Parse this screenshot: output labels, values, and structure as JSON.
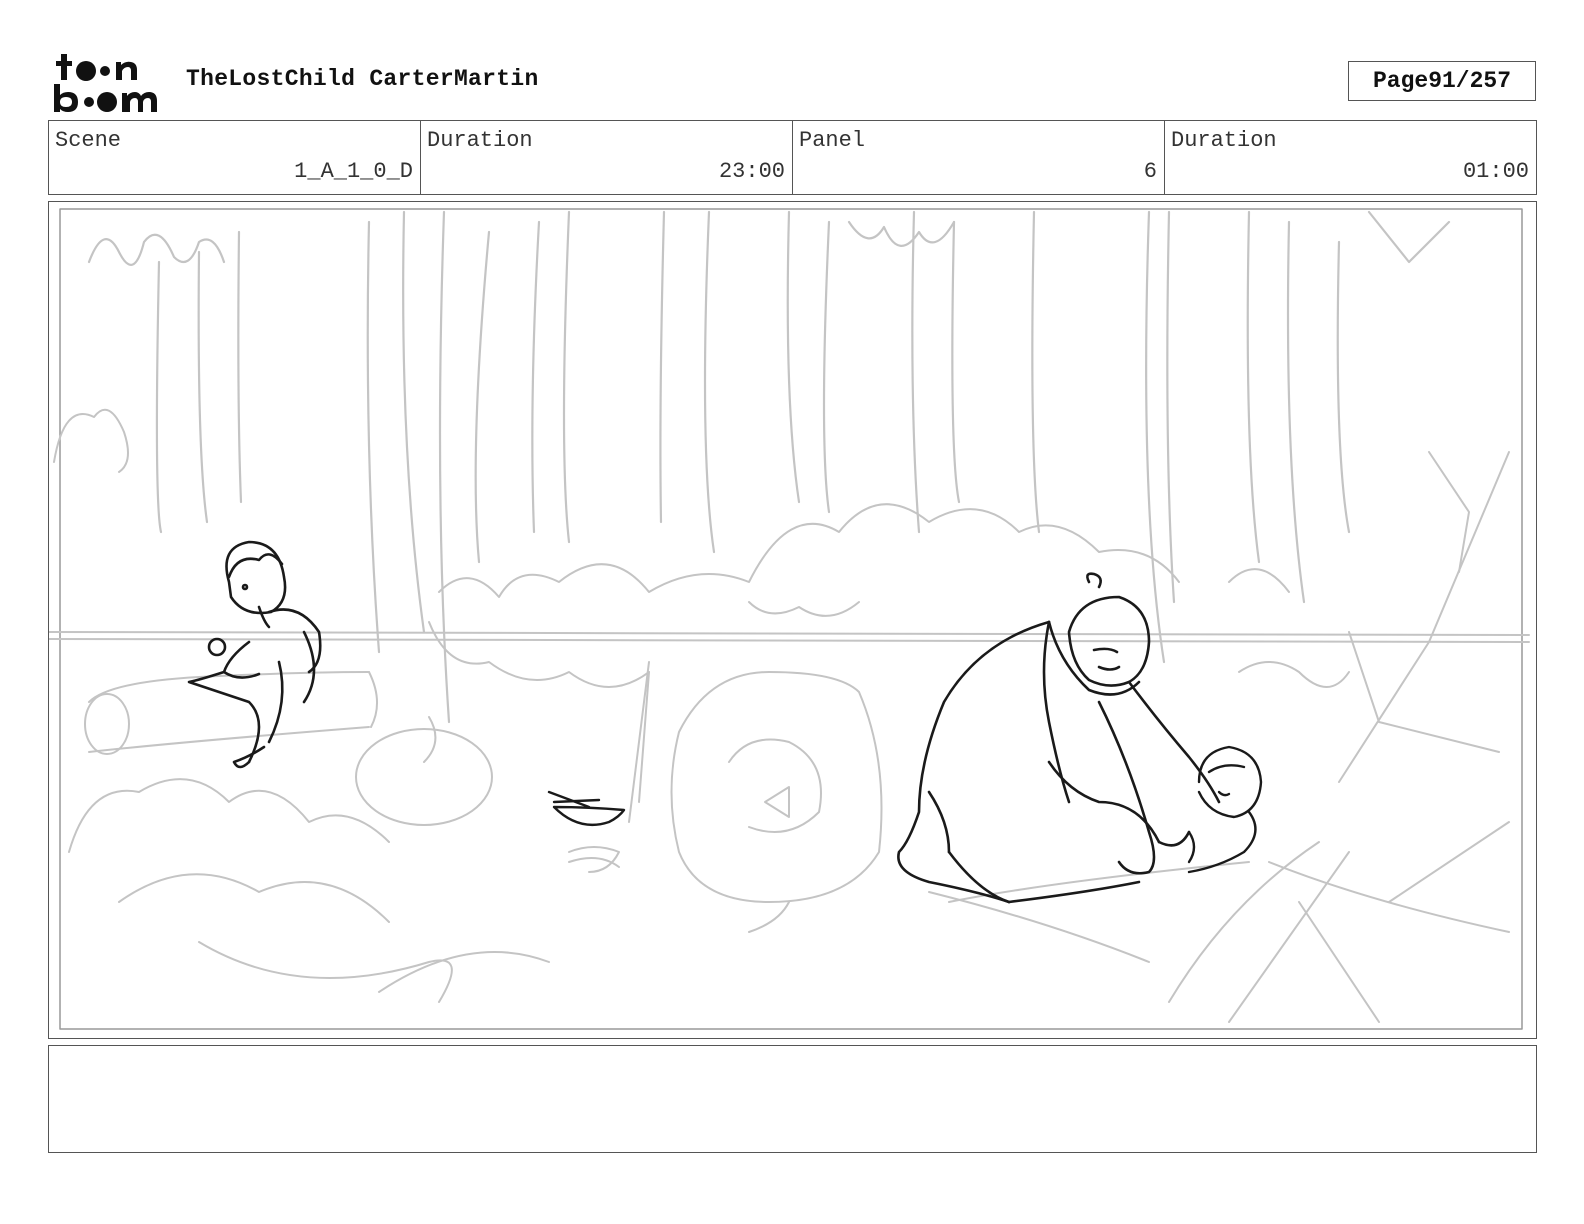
{
  "header": {
    "logo_text": "toon boom",
    "title": "TheLostChild CarterMartin",
    "page_label": "Page",
    "page_value": "91/257"
  },
  "info": {
    "scene_label": "Scene",
    "scene_value": "1_A_1_0_D",
    "scene_duration_label": "Duration",
    "scene_duration_value": "23:00",
    "panel_label": "Panel",
    "panel_value": "6",
    "panel_duration_label": "Duration",
    "panel_duration_value": "01:00"
  },
  "notes": {
    "text": ""
  },
  "colors": {
    "sketch_light": "#c2c2c2",
    "sketch_dark": "#1a1a1a",
    "border": "#555555"
  }
}
